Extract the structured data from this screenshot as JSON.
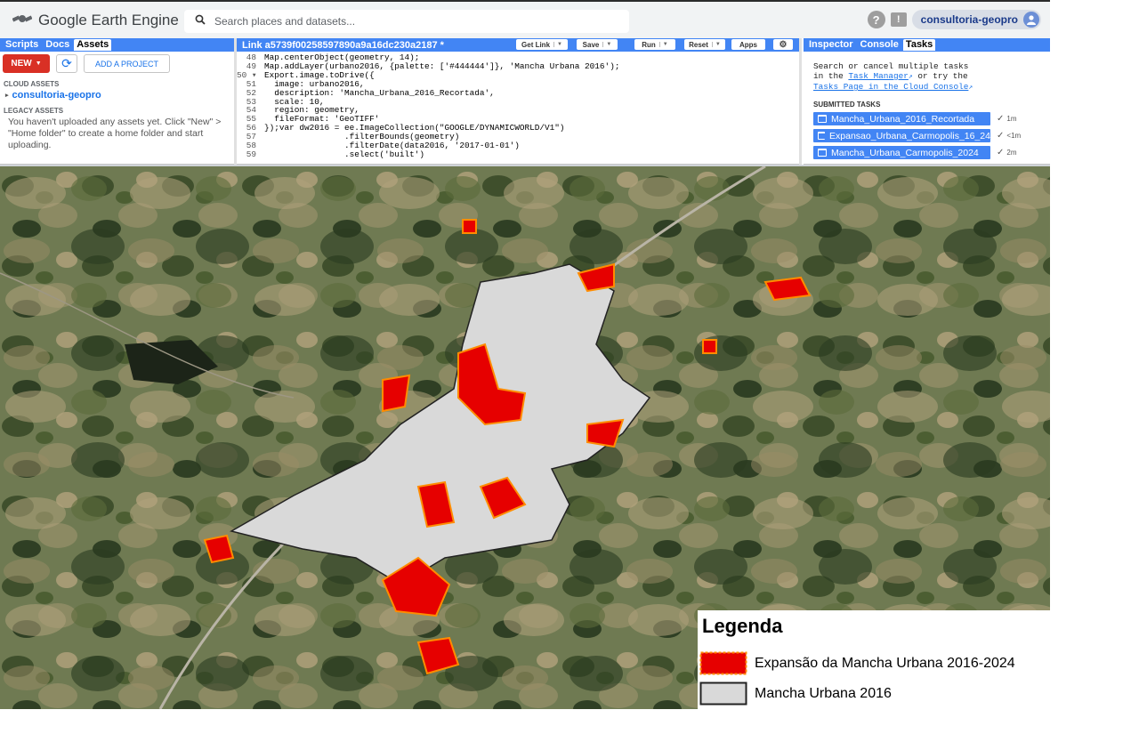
{
  "app": {
    "name": "Google Earth Engine"
  },
  "search": {
    "placeholder": "Search places and datasets..."
  },
  "header": {
    "help_icon": "?",
    "feedback_icon": "!",
    "user": "consultoria-geopro"
  },
  "left_panel": {
    "tabs": [
      "Scripts",
      "Docs",
      "Assets"
    ],
    "new_label": "NEW",
    "add_project_label": "ADD A PROJECT",
    "cloud_heading": "CLOUD ASSETS",
    "cloud_project": "consultoria-geopro",
    "legacy_heading": "LEGACY ASSETS",
    "legacy_text": "You haven't uploaded any assets yet. Click \"New\" > \"Home folder\" to create a home folder and start uploading."
  },
  "editor": {
    "title": "Link a5739f00258597890a9a16dc230a2187 *",
    "buttons": {
      "get_link": "Get Link",
      "save": "Save",
      "run": "Run",
      "reset": "Reset",
      "apps": "Apps"
    },
    "lines": [
      {
        "n": "48",
        "code": "Map.centerObject(geometry, 14);"
      },
      {
        "n": "49",
        "code": "Map.addLayer(urbano2016, {palette: ['#444444']}, 'Mancha Urbana 2016');"
      },
      {
        "n": "50 ▾",
        "code": "Export.image.toDrive({"
      },
      {
        "n": "51",
        "code": "  image: urbano2016,"
      },
      {
        "n": "52",
        "code": "  description: 'Mancha_Urbana_2016_Recortada',"
      },
      {
        "n": "53",
        "code": "  scale: 10,"
      },
      {
        "n": "54",
        "code": "  region: geometry,"
      },
      {
        "n": "55",
        "code": "  fileFormat: 'GeoTIFF'"
      },
      {
        "n": "56",
        "code": "});var dw2016 = ee.ImageCollection(\"GOOGLE/DYNAMICWORLD/V1\")"
      },
      {
        "n": "57",
        "code": "                .filterBounds(geometry)"
      },
      {
        "n": "58",
        "code": "                .filterDate(data2016, '2017-01-01')"
      },
      {
        "n": "59",
        "code": "                .select('built')"
      }
    ]
  },
  "right_panel": {
    "tabs": [
      "Inspector",
      "Console",
      "Tasks"
    ],
    "info_line1": "Search or cancel multiple tasks",
    "info_line2_pre": "in the ",
    "info_link1": "Task Manager",
    "info_line2_post": " or try the",
    "info_link2": "Tasks Page in the Cloud Console",
    "submitted_heading": "SUBMITTED TASKS",
    "tasks": [
      {
        "name": "Mancha_Urbana_2016_Recortada",
        "status": "✓",
        "time": "1m"
      },
      {
        "name": "Expansao_Urbana_Carmopolis_16_24",
        "status": "✓",
        "time": "<1m"
      },
      {
        "name": "Mancha_Urbana_Carmopolis_2024",
        "status": "✓",
        "time": "2m"
      }
    ]
  },
  "legend": {
    "title": "Legenda",
    "items": [
      {
        "label": "Expansão da Mancha Urbana 2016-2024",
        "color": "#e60000"
      },
      {
        "label": "Mancha Urbana 2016",
        "color": "#d9d9d9"
      }
    ]
  },
  "colors": {
    "accent": "#4285f4",
    "new_button": "#d93025",
    "expansion": "#e60000",
    "urban_2016": "#d9d9d9"
  }
}
